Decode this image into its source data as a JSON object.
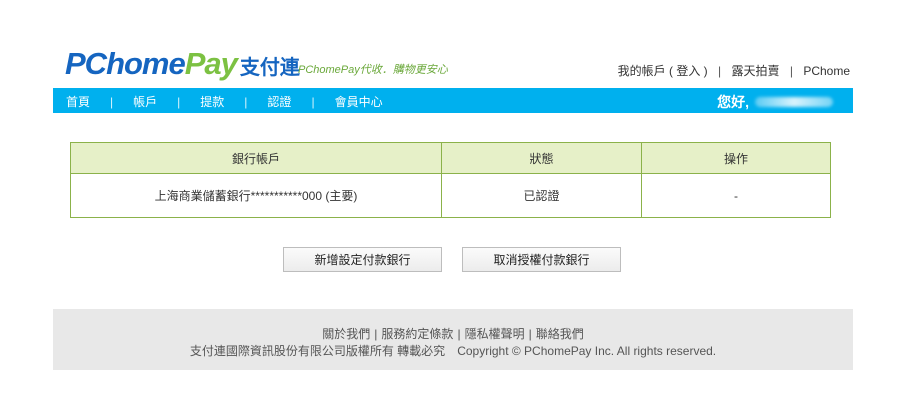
{
  "header": {
    "logo": {
      "p_text": "PChome",
      "pay_text": "Pay",
      "cn_text": "支付連"
    },
    "slogan": "PChomePay代收．購物更安心",
    "top_links": [
      {
        "label": "我的帳戶 ( 登入 )"
      },
      {
        "label": "露天拍賣"
      },
      {
        "label": "PChome"
      }
    ],
    "top_link_separator": "|"
  },
  "nav": {
    "items": [
      {
        "label": "首頁"
      },
      {
        "label": "帳戶"
      },
      {
        "label": "提款"
      },
      {
        "label": "認證"
      },
      {
        "label": "會員中心"
      }
    ],
    "separator": "|",
    "greeting": "您好,",
    "username_blurred": true
  },
  "bank_table": {
    "headers": [
      "銀行帳戶",
      "狀態",
      "操作"
    ],
    "rows": [
      {
        "account": "上海商業儲蓄銀行***********000 (主要)",
        "status": "已認證",
        "action": "-"
      }
    ]
  },
  "buttons": {
    "add_bank": "新增設定付款銀行",
    "cancel_bank": "取消授權付款銀行"
  },
  "footer": {
    "links": [
      {
        "label": "關於我們"
      },
      {
        "label": "服務約定條款"
      },
      {
        "label": "隱私權聲明"
      },
      {
        "label": "聯絡我們"
      }
    ],
    "separator": "|",
    "company": "支付連國際資訊股份有限公司版權所有 轉載必究",
    "copyright": "Copyright © PChomePay Inc. All rights reserved."
  },
  "colors": {
    "nav_bg": "#00b0ee",
    "logo_blue": "#1565c0",
    "logo_green": "#7cc142",
    "table_header_bg": "#e6f0c8",
    "table_border": "#8bb24a",
    "footer_bg": "#e8e8e8"
  }
}
